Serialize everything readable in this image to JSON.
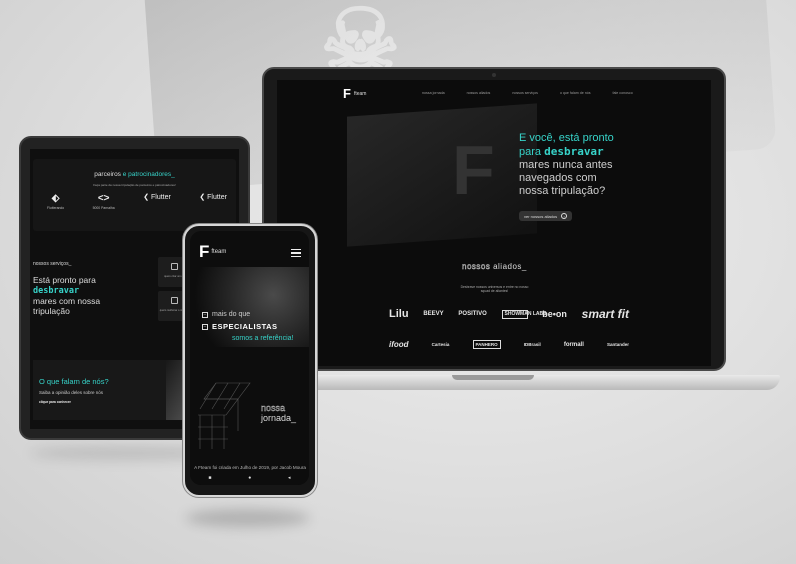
{
  "laptop": {
    "logo_mark": "F",
    "logo_word": "fteam",
    "nav": [
      "nossa jornada",
      "nossos aliados",
      "nossos serviços",
      "o que falam de nós",
      "fale conosco"
    ],
    "hero": {
      "line1": "E você, está pronto",
      "line2_plain": "para ",
      "line2_accent": "desbravar",
      "line3": "mares nunca antes",
      "line4": "navegados com",
      "line5": "nossa tripulação?"
    },
    "hero_button": "ver nossos aliados",
    "allies_title_outline": "nossos",
    "allies_title_rest": " aliados_",
    "allies_sub": "Desbrave nossos universos e entre no nosso squad de aliantes!",
    "logos_row1": [
      "Lilu",
      "BEEVY",
      "POSITIVO",
      "SHOWMAN LABS",
      "be•on",
      "smart fit"
    ],
    "logos_row2": [
      "ifood",
      "Cartesia",
      "PANHERO",
      "IDBrasil",
      "formall",
      "Santander"
    ]
  },
  "tablet": {
    "sponsors_title_plain": "parceiros",
    "sponsors_title_accent": " e patrocinadores_",
    "sponsors_sub": "Faça parte da nossa tripulação de parceiros e patrocinadores!",
    "sponsors": [
      {
        "icon": "flutterando-icon",
        "label": "Flutterando"
      },
      {
        "icon": "code-icon",
        "label": "5000 Parnalha"
      },
      {
        "icon": "flutter-icon",
        "label": "Flutter"
      },
      {
        "icon": "flutter-icon",
        "label": "Flutter"
      }
    ],
    "services_title": "nossos serviços_",
    "services_line1": "Está pronto para",
    "services_accent": "desbravar",
    "services_line3": "mares com nossa",
    "services_line4": "tripulação",
    "service_cards": [
      "quero criar um app",
      "quero melhorar o meu app"
    ],
    "testimonial_title": "O que falam de nós?",
    "testimonial_sub": "Saiba a opinião deles sobre nós",
    "testimonial_link": "clique para conhecer"
  },
  "phone": {
    "logo_mark": "F",
    "logo_word": "fteam",
    "row1": "mais do que",
    "row2": "ESPECIALISTAS",
    "row3": "somos a referência!",
    "jornada_outline": "nossa",
    "jornada_rest": "jornada_",
    "body_plain": "A Fteam foi criada em Julho de 2019, por Jacob Moura e Matheus Perez. Uma das ",
    "body_accent": "primeiras",
    "nav_icons": [
      "■",
      "●",
      "◂"
    ]
  },
  "colors": {
    "accent": "#37d3c9",
    "screen_bg": "#0c0c0c",
    "device_frame": "#1a1a1a"
  }
}
